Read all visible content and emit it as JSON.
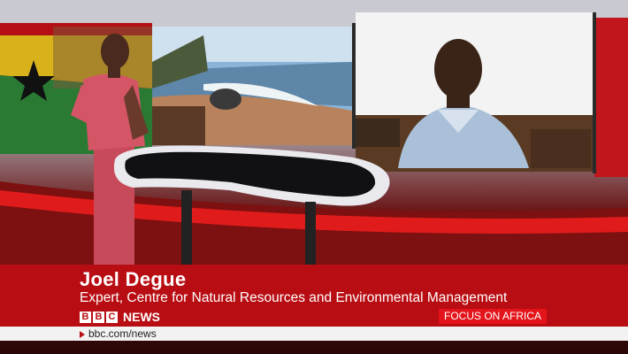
{
  "caption": {
    "name": "Joel Degue",
    "role": "Expert, Centre for Natural Resources and Environmental Management"
  },
  "channel": {
    "logo_letters": [
      "B",
      "B",
      "C"
    ],
    "logo_word": "NEWS",
    "programme": "FOCUS ON AFRICA"
  },
  "ticker": {
    "url": "bbc.com/news"
  },
  "colors": {
    "brand_red": "#b80d12",
    "programme_red": "#e3141a"
  }
}
